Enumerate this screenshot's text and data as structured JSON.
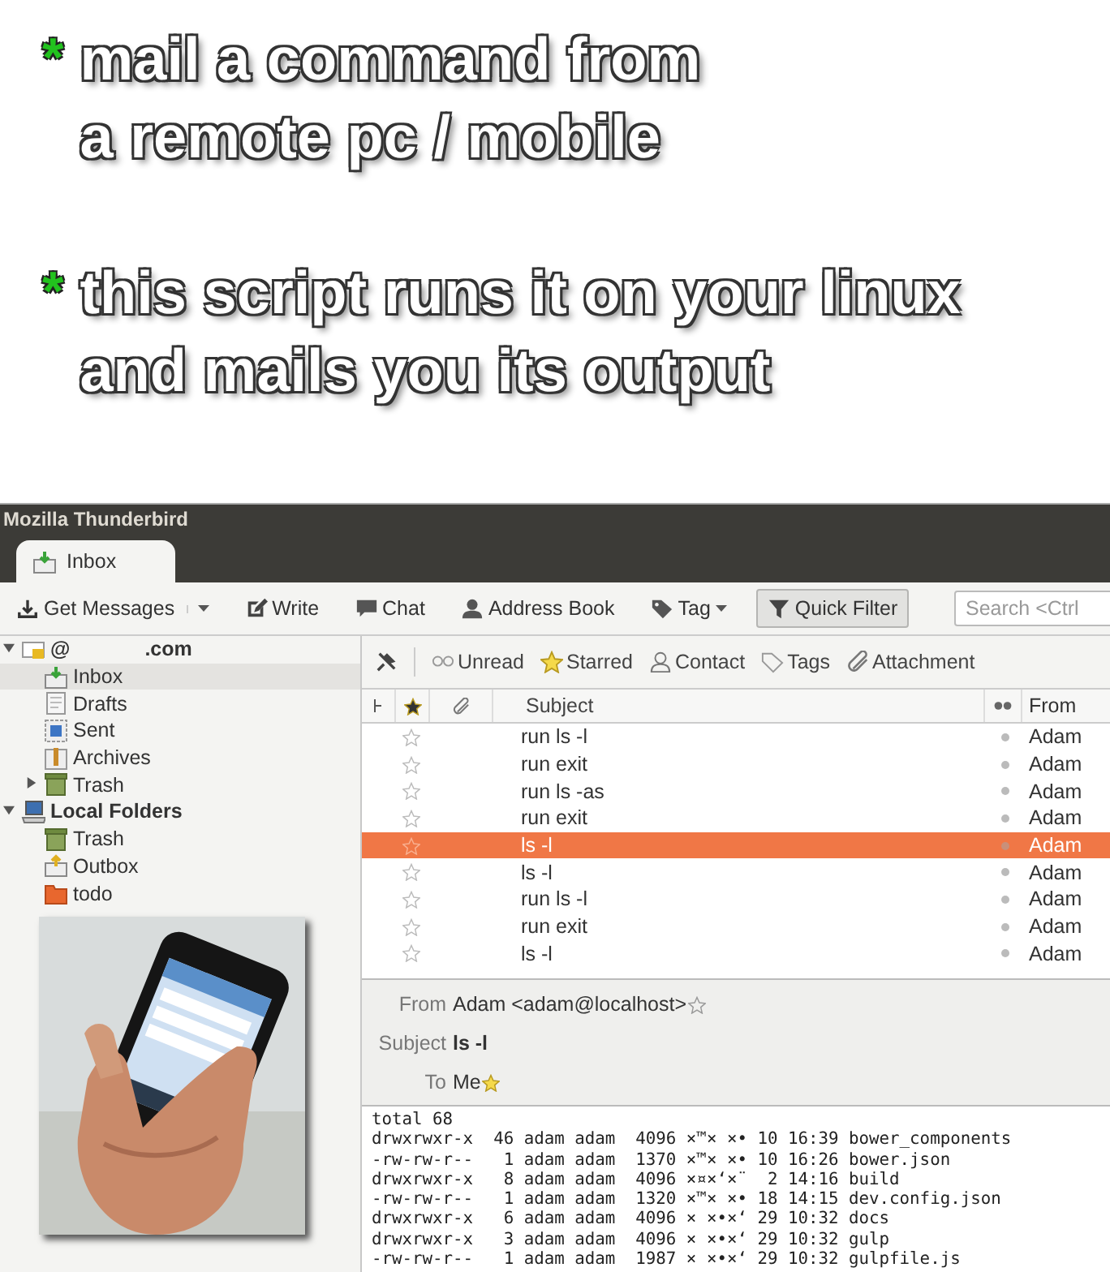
{
  "caption": {
    "bullets": [
      {
        "marker": "*",
        "lines": [
          "mail a command from",
          "a remote pc / mobile"
        ]
      },
      {
        "marker": "*",
        "lines": [
          "this script runs it on your linux",
          "and mails you its output"
        ]
      }
    ]
  },
  "window": {
    "title": "Mozilla Thunderbird"
  },
  "tabs": [
    {
      "label": "Inbox",
      "selected": true
    }
  ],
  "toolbar": [
    {
      "label": "Get Messages",
      "kind": "split",
      "on": false
    },
    {
      "label": "Write",
      "kind": "plain",
      "on": false
    },
    {
      "label": "Chat",
      "kind": "plain",
      "on": false
    },
    {
      "label": "Address Book",
      "kind": "plain",
      "on": false
    },
    {
      "label": "Tag",
      "kind": "menu",
      "on": false
    },
    {
      "label": "Quick Filter",
      "kind": "plain",
      "on": true
    }
  ],
  "search": {
    "placeholder": "Search <Ctrl"
  },
  "folders": [
    {
      "kind": "account",
      "name": [
        "@",
        ".com"
      ],
      "expanded": true,
      "selected": false,
      "children": [
        {
          "kind": "inbox",
          "name": [
            "Inbox"
          ],
          "selected": true
        },
        {
          "kind": "drafts",
          "name": [
            "Drafts"
          ],
          "selected": false
        },
        {
          "kind": "sent",
          "name": [
            "Sent"
          ],
          "selected": false
        },
        {
          "kind": "archives",
          "name": [
            "Archives"
          ],
          "selected": false
        },
        {
          "kind": "trash",
          "name": [
            "Trash"
          ],
          "expanded": false,
          "selected": false
        }
      ]
    },
    {
      "kind": "computer",
      "name": [
        "Local Folders"
      ],
      "expanded": true,
      "selected": false,
      "children": [
        {
          "kind": "trash",
          "name": [
            "Trash"
          ],
          "selected": false
        },
        {
          "kind": "outbox",
          "name": [
            "Outbox"
          ],
          "selected": false
        },
        {
          "kind": "folder",
          "name": [
            "todo"
          ],
          "selected": false
        }
      ]
    }
  ],
  "quick_filters": [
    "Unread",
    "Starred",
    "Contact",
    "Tags",
    "Attachment"
  ],
  "columns": {
    "subject": "Subject",
    "from": "From"
  },
  "messages": [
    {
      "subject": "run ls -l",
      "from": "Adam",
      "selected": false
    },
    {
      "subject": "run exit",
      "from": "Adam",
      "selected": false
    },
    {
      "subject": "run ls -as",
      "from": "Adam",
      "selected": false
    },
    {
      "subject": "run exit",
      "from": "Adam",
      "selected": false
    },
    {
      "subject": "ls -l",
      "from": "Adam",
      "selected": true
    },
    {
      "subject": "ls -l",
      "from": "Adam",
      "selected": false
    },
    {
      "subject": "run ls -l",
      "from": "Adam",
      "selected": false
    },
    {
      "subject": "run exit",
      "from": "Adam",
      "selected": false
    },
    {
      "subject": "ls -l",
      "from": "Adam",
      "selected": false
    }
  ],
  "header": {
    "from_label": "From",
    "from": "Adam <adam@localhost>",
    "subject_label": "Subject",
    "subject": "ls -l",
    "to_label": "To",
    "to": "Me"
  },
  "body": [
    "total 68",
    "drwxrwxr-x  46 adam adam  4096 ×™× ×• 10 16:39 bower_components",
    "-rw-rw-r--   1 adam adam  1370 ×™× ×• 10 16:26 bower.json",
    "drwxrwxr-x   8 adam adam  4096 ×¤×‘×¨  2 14:16 build",
    "-rw-rw-r--   1 adam adam  1320 ×™× ×• 18 14:15 dev.config.json",
    "drwxrwxr-x   6 adam adam  4096 × ×•×‘ 29 10:32 docs",
    "drwxrwxr-x   3 adam adam  4096 × ×•×‘ 29 10:32 gulp",
    "-rw-rw-r--   1 adam adam  1987 × ×•×‘ 29 10:32 gulpfile.js"
  ]
}
